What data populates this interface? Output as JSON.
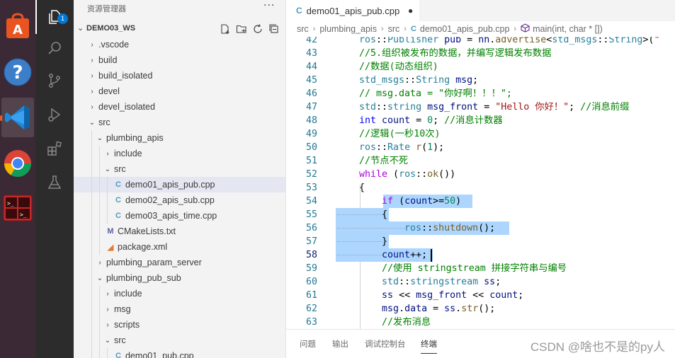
{
  "explorer": {
    "title": "资源管理器",
    "more": "···",
    "workspace": "DEMO03_WS",
    "items": [
      {
        "label": ".vscode",
        "chev": "›"
      },
      {
        "label": "build",
        "chev": "›"
      },
      {
        "label": "build_isolated",
        "chev": "›"
      },
      {
        "label": "devel",
        "chev": "›"
      },
      {
        "label": "devel_isolated",
        "chev": "›"
      },
      {
        "label": "src",
        "chev": "⌄"
      },
      {
        "label": "plumbing_apis",
        "chev": "⌄"
      },
      {
        "label": "include",
        "chev": "›"
      },
      {
        "label": "src",
        "chev": "⌄"
      },
      {
        "label": "demo01_apis_pub.cpp",
        "icon": "C"
      },
      {
        "label": "demo02_apis_sub.cpp",
        "icon": "C"
      },
      {
        "label": "demo03_apis_time.cpp",
        "icon": "C"
      },
      {
        "label": "CMakeLists.txt",
        "icon": "M"
      },
      {
        "label": "package.xml",
        "icon": "rss"
      },
      {
        "label": "plumbing_param_server",
        "chev": "›"
      },
      {
        "label": "plumbing_pub_sub",
        "chev": "⌄"
      },
      {
        "label": "include",
        "chev": "›"
      },
      {
        "label": "msg",
        "chev": "›"
      },
      {
        "label": "scripts",
        "chev": "›"
      },
      {
        "label": "src",
        "chev": "⌄"
      },
      {
        "label": "demo01_pub.cpp",
        "icon": "C"
      }
    ]
  },
  "activity": {
    "badge": "1"
  },
  "tab": {
    "label": "demo01_apis_pub.cpp",
    "dirty": "●",
    "icon": "C"
  },
  "breadcrumb": {
    "parts": [
      "src",
      "plumbing_apis",
      "src",
      "demo01_apis_pub.cpp",
      "main(int, char * [])"
    ]
  },
  "editor": {
    "line_numbers": [
      "42",
      "43",
      "44",
      "45",
      "46",
      "47",
      "48",
      "49",
      "50",
      "51",
      "52",
      "53",
      "54",
      "55",
      "56",
      "57",
      "58",
      "59",
      "60",
      "61",
      "62",
      "63"
    ],
    "current_line": "58"
  },
  "panel": {
    "tabs": [
      "问题",
      "输出",
      "调试控制台",
      "终端"
    ],
    "active": "终端"
  },
  "watermark": "CSDN @啥也不是的py人",
  "colors": {
    "dock": "#3b2a35",
    "activity_bar": "#2c2c2c",
    "sidebar": "#f3f3f3",
    "selection": "#add6ff",
    "accent": "#0078d4"
  }
}
